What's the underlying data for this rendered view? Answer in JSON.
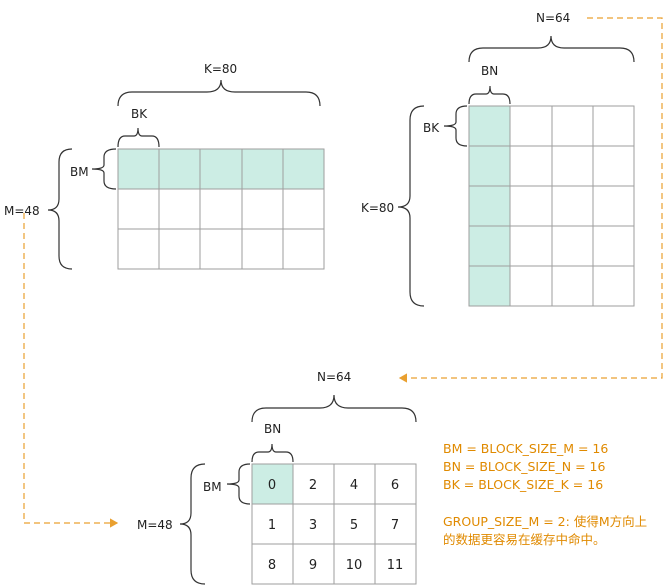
{
  "colors": {
    "highlight": "#ccede4",
    "grid": "#9e9e9e",
    "arrow": "#e9a030",
    "note_text": "#e08a00"
  },
  "matrix_a": {
    "k_label": "K=80",
    "bk_label": "BK",
    "bm_label": "BM",
    "m_label": "M=48"
  },
  "matrix_b": {
    "n_label": "N=64",
    "bn_label": "BN",
    "bk_label": "BK",
    "k_label": "K=80"
  },
  "matrix_c": {
    "n_label": "N=64",
    "bn_label": "BN",
    "bm_label": "BM",
    "m_label": "M=48",
    "block_ids": [
      "0",
      "1",
      "2",
      "3",
      "4",
      "5",
      "6",
      "7",
      "8",
      "9",
      "10",
      "11"
    ]
  },
  "notes": {
    "line1": "BM = BLOCK_SIZE_M = 16",
    "line2": "BN = BLOCK_SIZE_N = 16",
    "line3": "BK = BLOCK_SIZE_K = 16",
    "line4": "GROUP_SIZE_M = 2: 使得M方向上",
    "line5": "的数据更容易在缓存中命中。"
  }
}
